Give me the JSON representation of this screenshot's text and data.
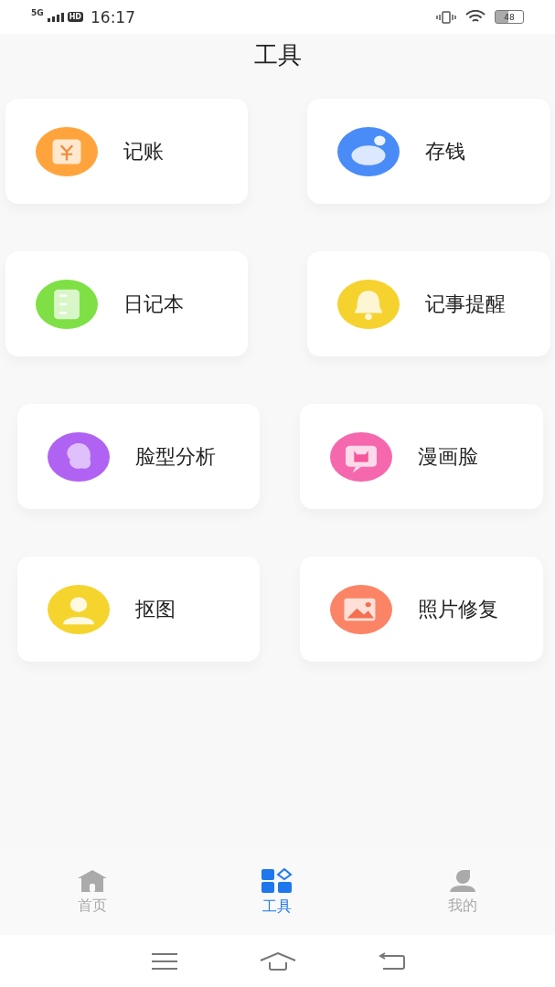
{
  "status_bar": {
    "network": "5G",
    "hd": "HD",
    "time": "16:17",
    "battery": "48"
  },
  "title": "工具",
  "tools": [
    {
      "label": "记账",
      "color": "#ffa43c"
    },
    {
      "label": "存钱",
      "color": "#4a8cf7"
    },
    {
      "label": "日记本",
      "color": "#7ee044"
    },
    {
      "label": "记事提醒",
      "color": "#f5d22e"
    },
    {
      "label": "脸型分析",
      "color": "#b063f2"
    },
    {
      "label": "漫画脸",
      "color": "#f568ad"
    },
    {
      "label": "抠图",
      "color": "#f5d42e"
    },
    {
      "label": "照片修复",
      "color": "#fb8466"
    }
  ],
  "tabs": [
    {
      "label": "首页",
      "selected": false
    },
    {
      "label": "工具",
      "selected": true
    },
    {
      "label": "我的",
      "selected": false
    }
  ]
}
